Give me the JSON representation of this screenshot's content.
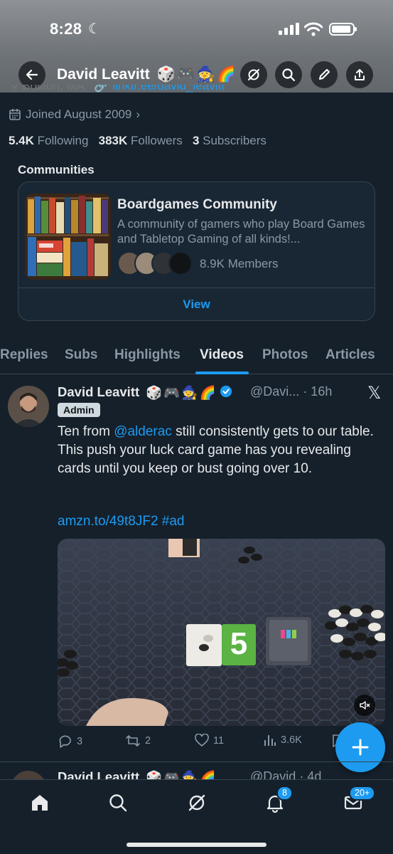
{
  "status_bar": {
    "time": "8:28"
  },
  "header": {
    "name": "David Leavitt",
    "emojis": [
      "🎲",
      "🎮",
      "🧙",
      "🌈"
    ]
  },
  "profile": {
    "location_clip": "Boston, MA",
    "link_clip": "linktr.ee/david_leavitt",
    "joined": "Joined August 2009",
    "following_count": "5.4K",
    "following_label": "Following",
    "followers_count": "383K",
    "followers_label": "Followers",
    "subscribers_count": "3",
    "subscribers_label": "Subscribers"
  },
  "communities": {
    "heading": "Communities",
    "card": {
      "name": "Boardgames Community",
      "description": "A community of gamers who play Board Games and Tabletop Gaming of all kinds!...",
      "members": "8.9K Members",
      "view_label": "View"
    }
  },
  "tabs": [
    {
      "label": "Replies"
    },
    {
      "label": "Subs"
    },
    {
      "label": "Highlights"
    },
    {
      "label": "Videos",
      "active": true
    },
    {
      "label": "Photos"
    },
    {
      "label": "Articles"
    }
  ],
  "post": {
    "author": "David Leavitt",
    "emojis": [
      "🎲",
      "🎮",
      "🧙",
      "🌈"
    ],
    "handle": "@Davi...",
    "time": "· 16h",
    "badge": "Admin",
    "text_before": "Ten from ",
    "mention": "@alderac",
    "text_after": " still consistently gets to our table. This push your luck card game has you revealing cards until you keep or bust going over 10.",
    "link": "amzn.to/49t8JF2 #ad",
    "replies": "3",
    "reposts": "2",
    "likes": "11",
    "views": "3.6K",
    "card_value": "5"
  },
  "post2": {
    "author": "David Leavitt",
    "handle": "@David",
    "time": "· 4d"
  },
  "nav": {
    "notifications_badge": "8",
    "messages_badge": "20+"
  },
  "colors": {
    "accent": "#1d9bf0",
    "background": "#15202b",
    "border": "#38444d"
  }
}
